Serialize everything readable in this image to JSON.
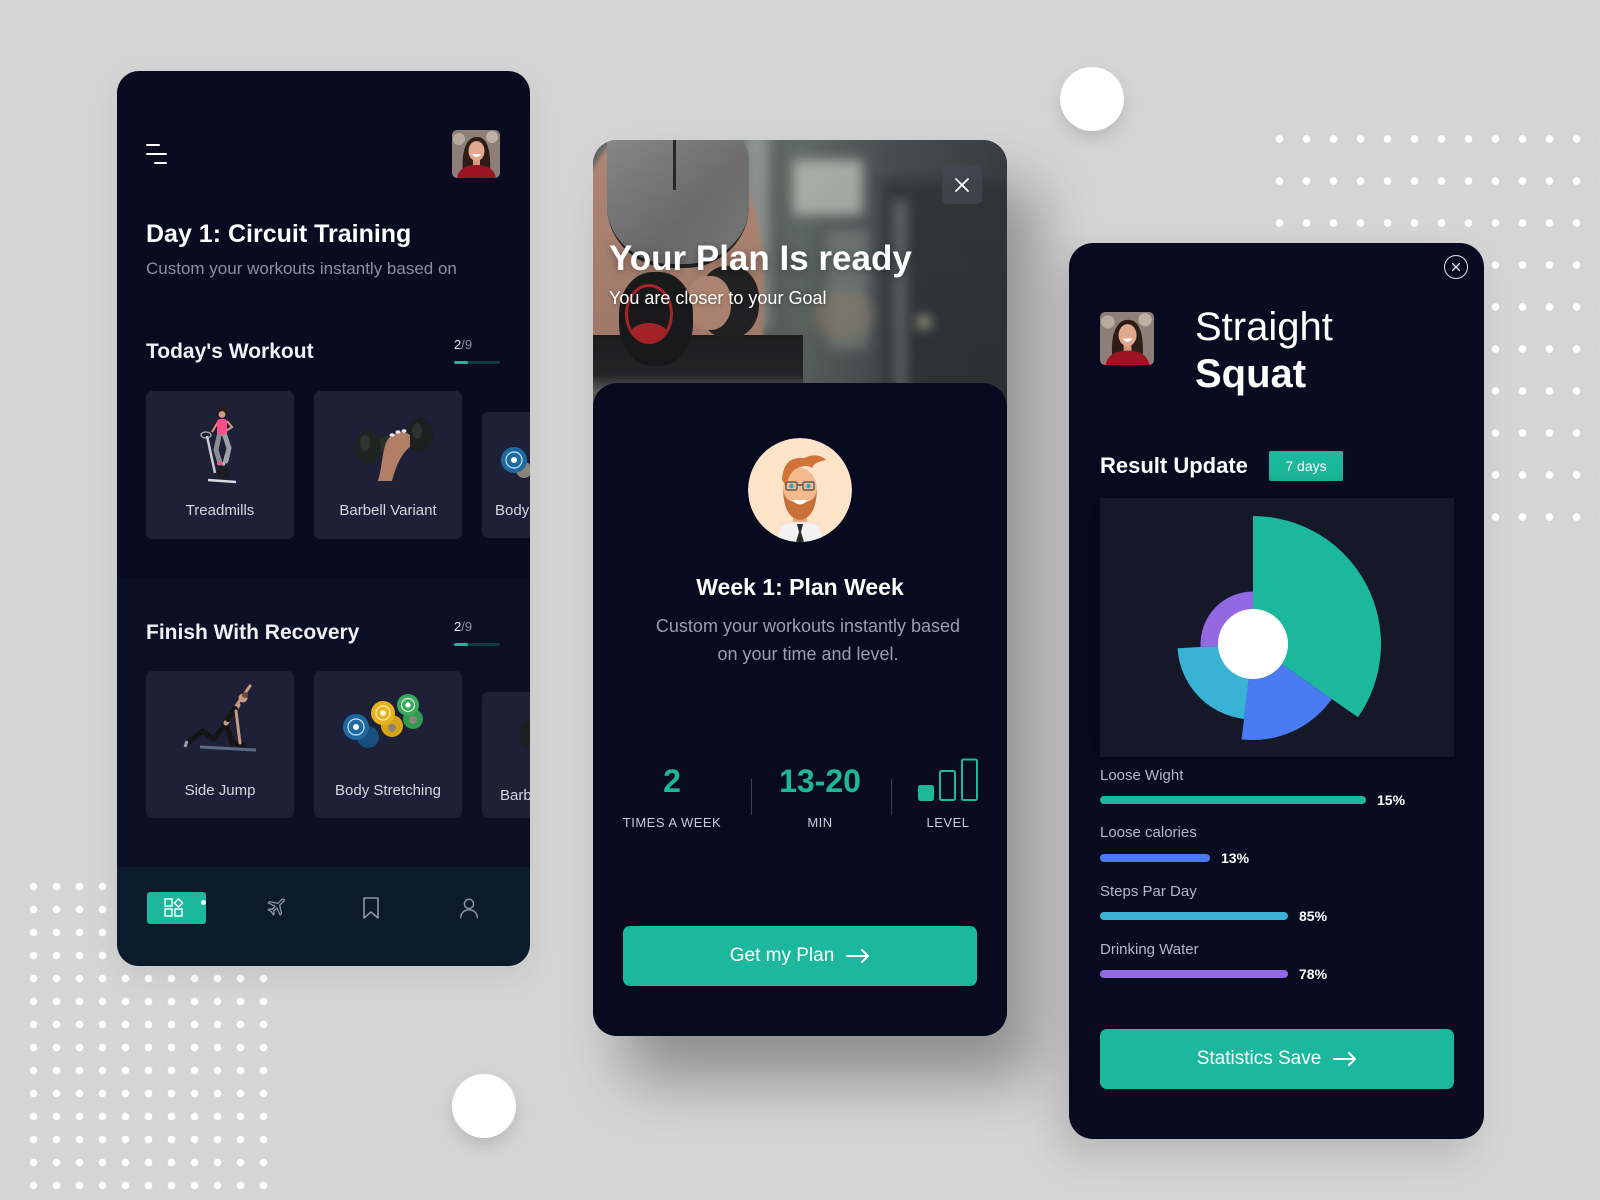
{
  "theme": {
    "page_bg": "#d5d5d5",
    "panel_bg": "#090b20",
    "card_bg": "#1d2036",
    "accent": "#1cb89d",
    "blue": "#4b7bf3",
    "cyan": "#38b3d5",
    "purple": "#9468e0",
    "text_muted": "#8b8fa6"
  },
  "left_panel": {
    "menu_icon": "hamburger-menu-icon",
    "avatar": "user-avatar",
    "title": "Day 1: Circuit Training",
    "subtitle": "Custom your workouts instantly based on",
    "sections": [
      {
        "title": "Today's Workout",
        "progress": {
          "current": "2",
          "total_label": "/9",
          "fill": 0.3
        },
        "cards": [
          {
            "label": "Treadmills",
            "icon": "exercise-bike-icon"
          },
          {
            "label": "Barbell Variant",
            "icon": "dumbbell-icon"
          },
          {
            "label": "Body",
            "icon": "weight-plate-icon"
          }
        ]
      },
      {
        "title": "Finish With Recovery",
        "progress": {
          "current": "2",
          "total_label": "/9",
          "fill": 0.3
        },
        "cards": [
          {
            "label": "Side Jump",
            "icon": "yoga-pose-icon"
          },
          {
            "label": "Body Stretching",
            "icon": "weight-plates-icon"
          },
          {
            "label": "Barb",
            "icon": "dumbbell-icon"
          }
        ]
      }
    ],
    "bottom_nav": [
      {
        "icon": "dashboard-icon",
        "active": true,
        "has_dot": true
      },
      {
        "icon": "airplane-icon",
        "active": false
      },
      {
        "icon": "bookmark-icon",
        "active": false
      },
      {
        "icon": "user-icon",
        "active": false
      }
    ]
  },
  "plan_panel": {
    "hero_title": "Your Plan Is ready",
    "hero_subtitle": "You are closer to your Goal",
    "close_icon": "close-icon",
    "trainer_avatar": "cartoon-trainer-avatar",
    "week_title": "Week 1: Plan Week",
    "description_lines": [
      "Custom your workouts instantly based",
      "on your time and level."
    ],
    "stats": [
      {
        "value": "2",
        "label": "TIMES A WEEK"
      },
      {
        "value": "13-20",
        "label": "MIN"
      },
      {
        "icon": "level-bars-icon",
        "label": "LEVEL",
        "level": 1,
        "level_max": 3
      }
    ],
    "cta_label": "Get my Plan",
    "cta_icon": "arrow-right-icon"
  },
  "stats_panel": {
    "close_icon": "close-circle-icon",
    "avatar": "user-avatar",
    "title_light": "Straight",
    "title_bold": "Squat",
    "section_title": "Result Update",
    "period_badge": "7 days",
    "metrics": [
      {
        "label": "Loose Wight",
        "value": "15%",
        "color": "#1cb89d",
        "bar_fill": 0.75
      },
      {
        "label": "Loose calories",
        "value": "13%",
        "color": "#4b7bf3",
        "bar_fill": 0.31
      },
      {
        "label": "Steps Par Day",
        "value": "85%",
        "color": "#38b3d5",
        "bar_fill": 0.53
      },
      {
        "label": "Drinking Water",
        "value": "78%",
        "color": "#9468e0",
        "bar_fill": 0.53
      }
    ],
    "cta_label": "Statistics Save",
    "cta_icon": "arrow-right-icon"
  },
  "chart_data": {
    "type": "pie",
    "variant": "polar-area (radius varies per slice, white center hole)",
    "title": "",
    "start": "top",
    "direction": "clockwise",
    "legend": "none (colors match metric bars below)",
    "slices": [
      {
        "series": "Loose Wight",
        "color": "#1cb89d",
        "share": 0.347,
        "magnitude": 1.0
      },
      {
        "series": "Loose calories",
        "color": "#4b7bf3",
        "share": 0.172,
        "magnitude": 0.75
      },
      {
        "series": "Steps Par Day",
        "color": "#38b3d5",
        "share": 0.222,
        "magnitude": 0.59
      },
      {
        "series": "Drinking Water",
        "color": "#9468e0",
        "share": 0.259,
        "magnitude": 0.41
      }
    ]
  }
}
